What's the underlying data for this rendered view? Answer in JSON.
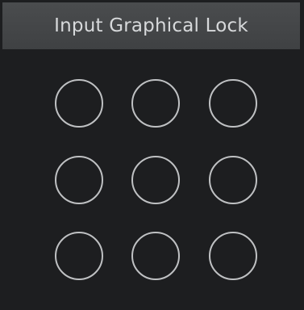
{
  "dialog": {
    "title": "Input Graphical Lock"
  },
  "pattern_grid": {
    "rows": 3,
    "columns": 3,
    "nodes": [
      {
        "id": 1,
        "selected": false
      },
      {
        "id": 2,
        "selected": false
      },
      {
        "id": 3,
        "selected": false
      },
      {
        "id": 4,
        "selected": false
      },
      {
        "id": 5,
        "selected": false
      },
      {
        "id": 6,
        "selected": false
      },
      {
        "id": 7,
        "selected": false
      },
      {
        "id": 8,
        "selected": false
      },
      {
        "id": 9,
        "selected": false
      }
    ]
  },
  "colors": {
    "background": "#1d1e20",
    "title_bar": "#444648",
    "title_text": "#d7d9db",
    "node_ring": "#bfc1c3"
  }
}
